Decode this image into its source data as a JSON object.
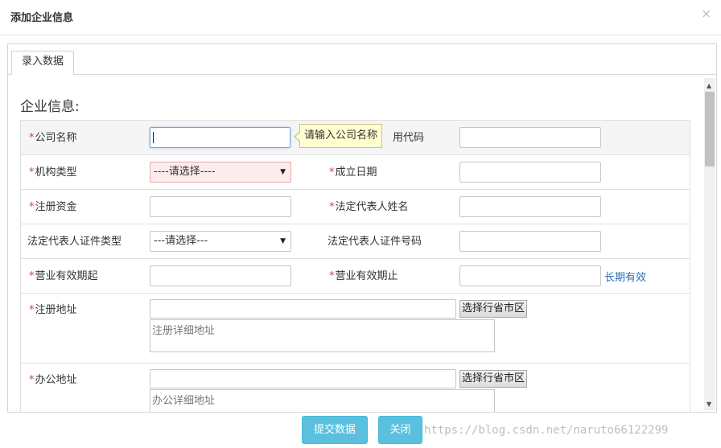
{
  "dialog": {
    "title": "添加企业信息",
    "close_glyph": "×",
    "tab_label": "录入数据",
    "section_title": "企业信息:"
  },
  "form": {
    "required_mark": "*",
    "company_name_label": "公司名称",
    "company_name_value": "",
    "company_name_tooltip": "请输入公司名称",
    "credit_code_label": "统一社会信用代码",
    "credit_code_visible_label": "用代码",
    "credit_code_value": "",
    "org_type_label": "机构类型",
    "org_type_selected": "----请选择----",
    "found_date_label": "成立日期",
    "found_date_value": "",
    "reg_capital_label": "注册资金",
    "reg_capital_value": "",
    "legal_rep_name_label": "法定代表人姓名",
    "legal_rep_name_value": "",
    "legal_rep_cert_type_label": "法定代表人证件类型",
    "legal_rep_cert_type_selected": "---请选择---",
    "legal_rep_cert_no_label": "法定代表人证件号码",
    "legal_rep_cert_no_value": "",
    "biz_start_label": "营业有效期起",
    "biz_start_value": "",
    "biz_end_label": "营业有效期止",
    "biz_end_value": "",
    "long_term_link": "长期有效",
    "reg_address_label": "注册地址",
    "reg_address_value": "",
    "reg_region_button": "选择行省市区",
    "reg_detail_placeholder": "注册详细地址",
    "office_address_label": "办公地址",
    "office_address_value": "",
    "office_region_button": "选择行省市区",
    "office_detail_placeholder": "办公详细地址",
    "dropdown_arrow": "▼"
  },
  "scrollbar": {
    "up": "▲",
    "down": "▼"
  },
  "footer": {
    "submit_label": "提交数据",
    "close_label": "关闭"
  },
  "watermark": "https://blog.csdn.net/naruto66122299",
  "colors": {
    "required": "#e4393c",
    "button": "#5bc0de",
    "link": "#2a6eb8",
    "tooltip_bg": "#ffffd0",
    "error_select_bg": "#fdeced"
  }
}
